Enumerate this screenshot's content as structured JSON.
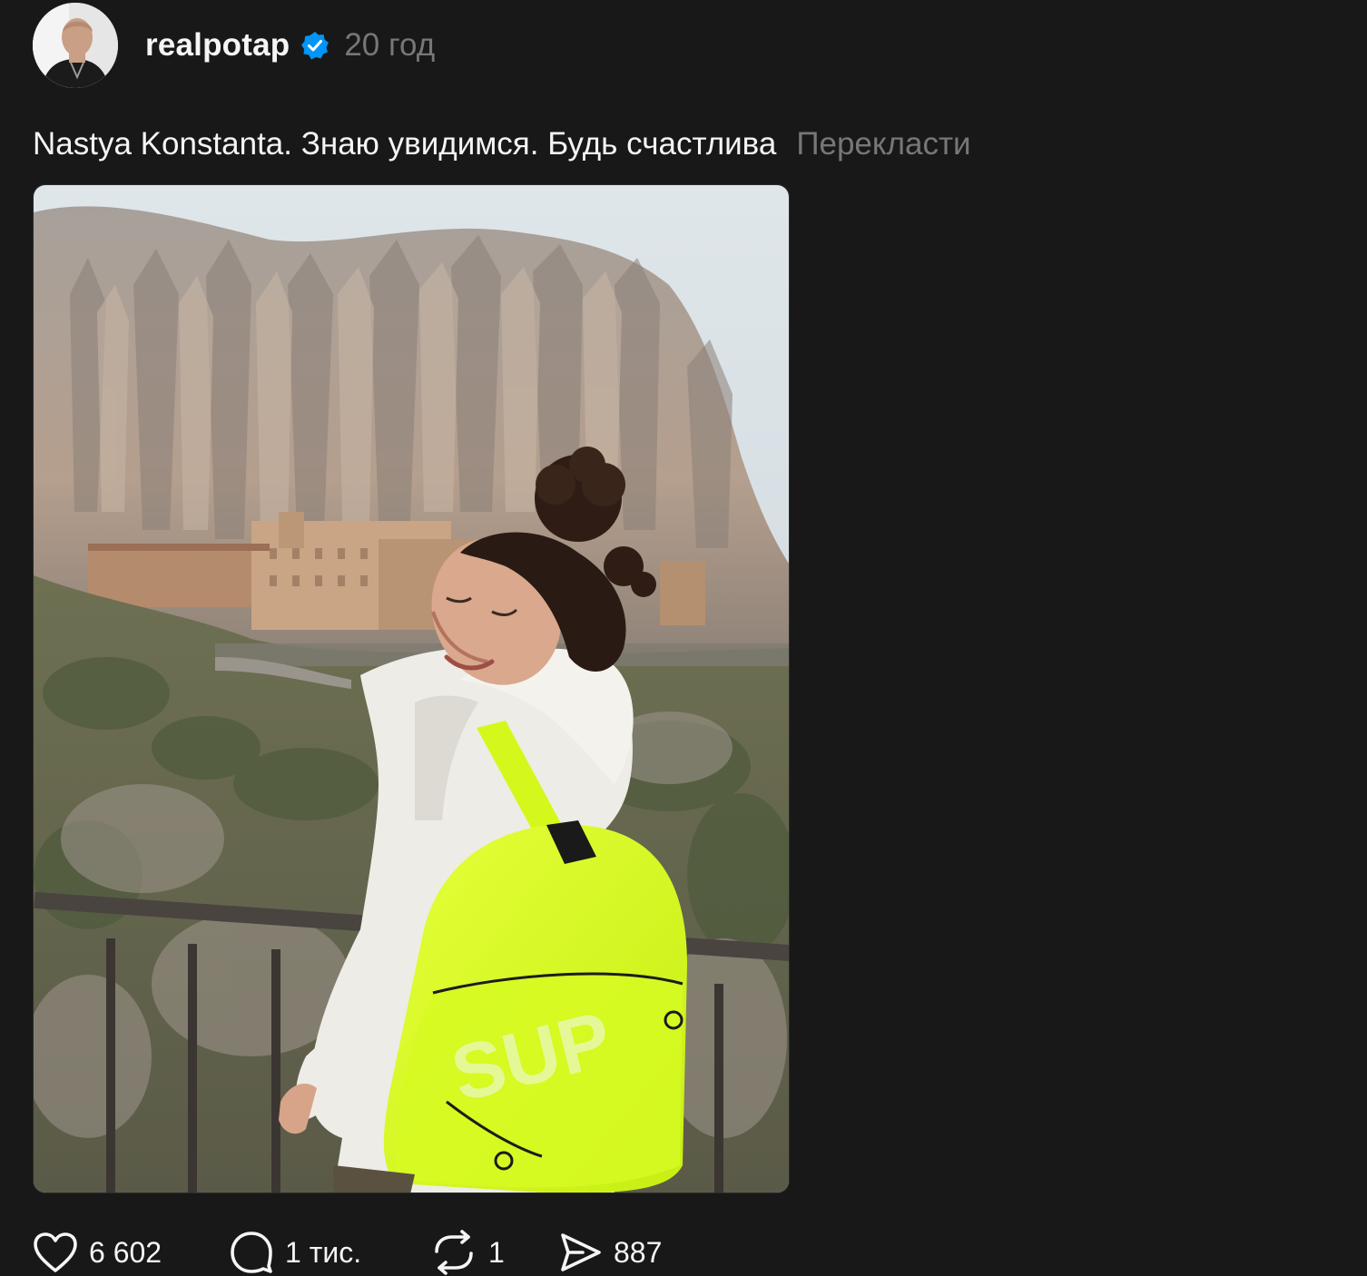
{
  "post": {
    "username": "realpotap",
    "verified": true,
    "time": "20 год",
    "caption": "Nastya Konstanta. Знаю увидимся. Будь счастлива",
    "translate_label": "Перекласти",
    "image_alt": "photo"
  },
  "actions": {
    "likes": "6 602",
    "comments": "1 тис.",
    "reposts": "1",
    "shares": "887"
  },
  "colors": {
    "background": "#181818",
    "text": "#f3f5f7",
    "secondary": "#777777",
    "verified": "#0095f6",
    "backpack": "#d9ff1e"
  },
  "icons": [
    "heart-icon",
    "comment-icon",
    "repost-icon",
    "share-icon",
    "verified-badge-icon"
  ]
}
